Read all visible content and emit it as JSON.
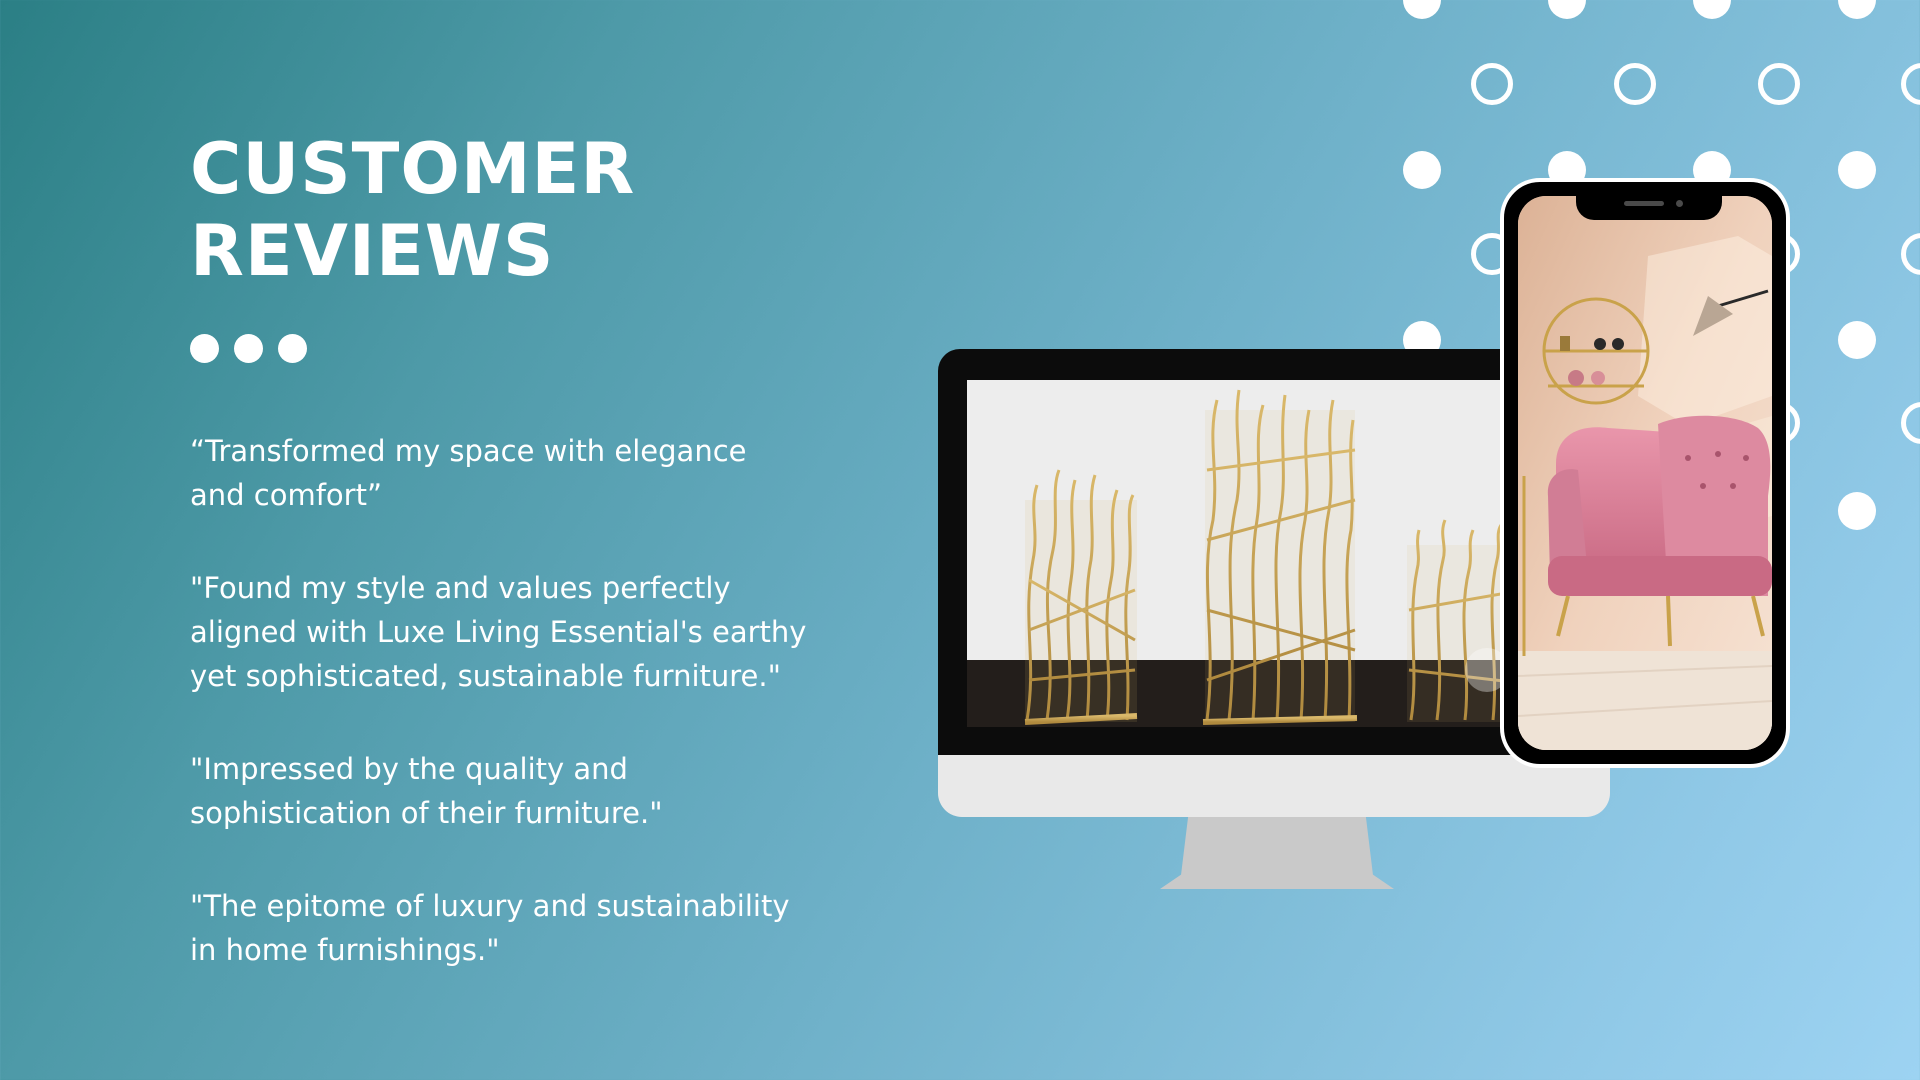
{
  "slide": {
    "title_line1": "CUSTOMER",
    "title_line2": "REVIEWS",
    "reviews": [
      "“Transformed my space with elegance and comfort”",
      "\"Found my style and values perfectly aligned with Luxe  Living Essential's earthy yet sophisticated, sustainable furniture.\"",
      "\"Impressed by the quality and sophistication of their furniture.\"",
      "\"The epitome of luxury and sustainability in home furnishings.\""
    ]
  },
  "devices": {
    "monitor_image": "golden branch lantern sculptures",
    "phone_image": "pink velvet armchair with gold wall shelf and lamp"
  },
  "colors": {
    "gradient_start": "#2b7f85",
    "gradient_end": "#9dd3f2",
    "text": "#ffffff",
    "accent_gold": "#c9a24a",
    "accent_pink": "#e38aa0"
  }
}
